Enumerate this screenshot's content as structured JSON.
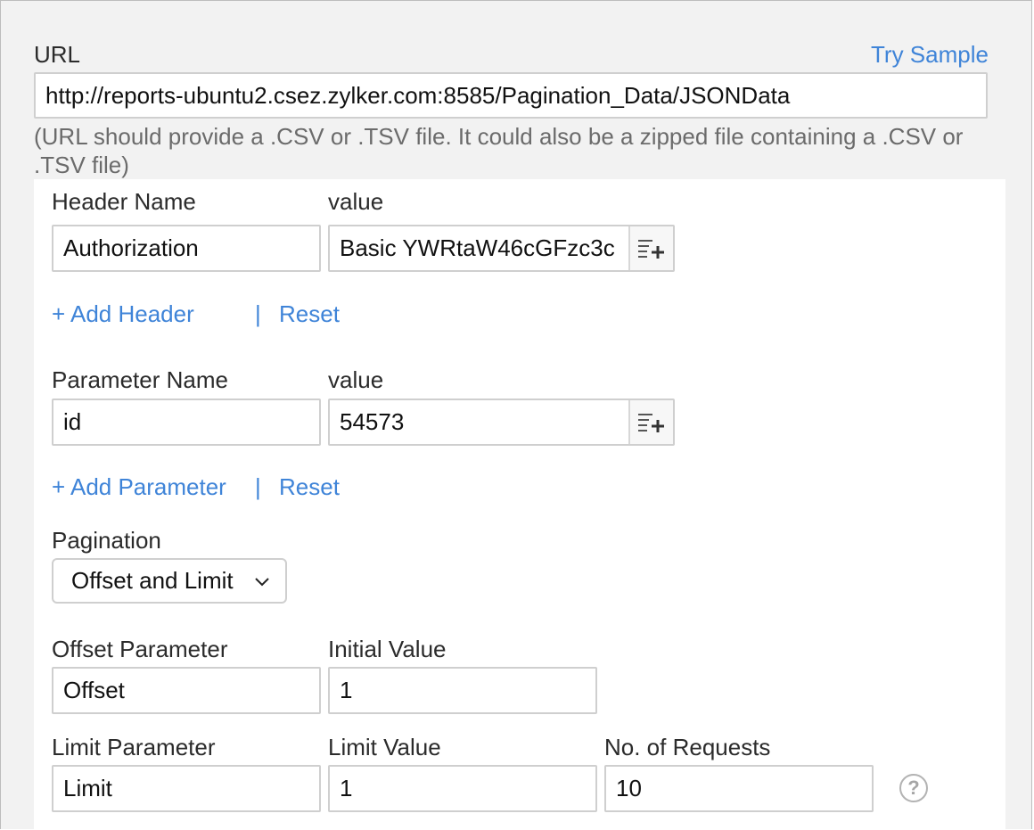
{
  "url_section": {
    "label": "URL",
    "try_sample": "Try Sample",
    "value": "http://reports-ubuntu2.csez.zylker.com:8585/Pagination_Data/JSONData",
    "hint_line1": "(URL should provide a .CSV or .TSV file. It could also be a zipped file containing a .CSV or",
    "hint_line2": ".TSV file)"
  },
  "headers": {
    "name_label": "Header Name",
    "value_label": "value",
    "name": "Authorization",
    "value": "Basic YWRtaW46cGFzc3c",
    "add_label": "+ Add Header",
    "separator": "|",
    "reset_label": "Reset"
  },
  "parameters": {
    "name_label": "Parameter Name",
    "value_label": "value",
    "name": "id",
    "value": "54573",
    "add_label": "+ Add Parameter",
    "separator": "|",
    "reset_label": "Reset"
  },
  "pagination": {
    "label": "Pagination",
    "selected": "Offset and Limit",
    "offset_param_label": "Offset Parameter",
    "offset_param": "Offset",
    "initial_value_label": "Initial Value",
    "initial_value": "1",
    "limit_param_label": "Limit Parameter",
    "limit_param": "Limit",
    "limit_value_label": "Limit Value",
    "limit_value": "1",
    "requests_label": "No. of Requests",
    "requests": "10",
    "help_symbol": "?"
  },
  "icons": {
    "insert_variable": "list-add-icon",
    "dropdown": "chevron-down-icon",
    "help": "help-icon"
  },
  "colors": {
    "link": "#3f84d8",
    "background": "#f2f2f2",
    "panel": "#ffffff"
  }
}
